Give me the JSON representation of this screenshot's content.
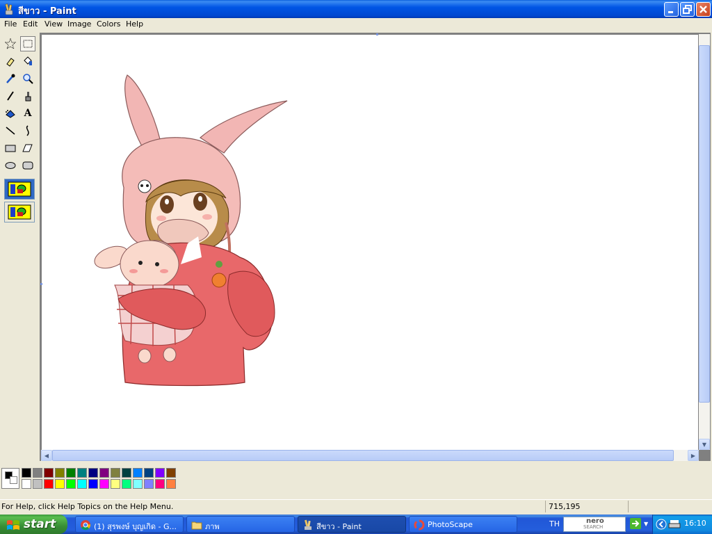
{
  "window": {
    "title": "สีขาว - Paint",
    "controls": {
      "minimize": "minimize",
      "maximize": "maximize",
      "close": "close"
    }
  },
  "menu": {
    "items": [
      "File",
      "Edit",
      "View",
      "Image",
      "Colors",
      "Help"
    ]
  },
  "toolbox": {
    "tools": [
      {
        "name": "free-form-select",
        "icon": "star-select-icon"
      },
      {
        "name": "select",
        "icon": "rect-select-icon",
        "selected": true
      },
      {
        "name": "eraser",
        "icon": "eraser-icon"
      },
      {
        "name": "fill-with-color",
        "icon": "paint-bucket-icon"
      },
      {
        "name": "pick-color",
        "icon": "eyedropper-icon"
      },
      {
        "name": "magnifier",
        "icon": "magnifier-icon"
      },
      {
        "name": "pencil",
        "icon": "pencil-icon"
      },
      {
        "name": "brush",
        "icon": "brush-icon"
      },
      {
        "name": "airbrush",
        "icon": "airbrush-icon"
      },
      {
        "name": "text",
        "icon": "text-icon",
        "glyph": "A"
      },
      {
        "name": "line",
        "icon": "line-icon"
      },
      {
        "name": "curve",
        "icon": "curve-icon"
      },
      {
        "name": "rectangle",
        "icon": "rectangle-icon"
      },
      {
        "name": "polygon",
        "icon": "polygon-icon"
      },
      {
        "name": "ellipse",
        "icon": "ellipse-icon"
      },
      {
        "name": "rounded-rectangle",
        "icon": "rounded-rect-icon"
      }
    ],
    "options": [
      "opaque-background-icon",
      "transparent-background-icon"
    ]
  },
  "palette": {
    "foreground": "#000000",
    "background": "#FFFFFF",
    "row1": [
      "#000000",
      "#808080",
      "#800000",
      "#808000",
      "#008000",
      "#008080",
      "#000080",
      "#800080",
      "#808040",
      "#004040",
      "#0080FF",
      "#004080",
      "#8000FF",
      "#804000"
    ],
    "row2": [
      "#FFFFFF",
      "#C0C0C0",
      "#FF0000",
      "#FFFF00",
      "#00FF00",
      "#00FFFF",
      "#0000FF",
      "#FF00FF",
      "#FFFF80",
      "#00FF80",
      "#80FFFF",
      "#8080FF",
      "#FF0080",
      "#FF8040"
    ]
  },
  "status": {
    "help": "For Help, click Help Topics on the Help Menu.",
    "coordinates": "715,195"
  },
  "taskbar": {
    "start_label": "start",
    "tasks": [
      {
        "label": "(1) สุรพงษ์ บุญเกิด - G...",
        "icon": "chrome-icon"
      },
      {
        "label": "ภาพ",
        "icon": "folder-icon"
      },
      {
        "label": "สีขาว - Paint",
        "icon": "paint-icon",
        "active": true
      },
      {
        "label": "PhotoScape",
        "icon": "photoscape-icon"
      }
    ],
    "language": "TH",
    "search_logo_top": "nero",
    "search_logo_bottom": "SEARCH",
    "clock": "16:10"
  }
}
